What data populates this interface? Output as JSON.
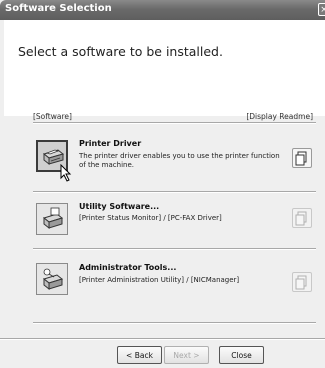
{
  "window": {
    "title": "Software Selection",
    "close_glyph": "×"
  },
  "heading": "Select a software to be installed.",
  "columns": {
    "software": "[Software]",
    "readme": "[Display Readme]"
  },
  "items": [
    {
      "title": "Printer Driver",
      "description": "The printer driver enables you to use the printer function of the machine.",
      "icon": "printer-icon",
      "selected": true,
      "readme_enabled": true
    },
    {
      "title": "Utility Software...",
      "description": "[Printer Status Monitor] / [PC-FAX Driver]",
      "icon": "utility-software-icon",
      "selected": false,
      "readme_enabled": false
    },
    {
      "title": "Administrator Tools...",
      "description": "[Printer Administration Utility] / [NICManager]",
      "icon": "administrator-tools-icon",
      "selected": false,
      "readme_enabled": false
    }
  ],
  "buttons": {
    "back": "< Back",
    "next": "Next >",
    "close": "Close"
  }
}
